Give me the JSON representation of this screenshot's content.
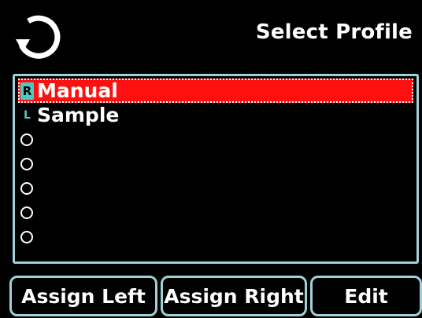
{
  "header": {
    "title": "Select Profile",
    "back_icon": "refresh-back-icon"
  },
  "list": {
    "items": [
      {
        "badge": "R",
        "label": "Manual",
        "selected": true
      },
      {
        "badge": "L",
        "label": "Sample",
        "selected": false
      },
      {
        "badge": "",
        "label": "",
        "selected": false
      },
      {
        "badge": "",
        "label": "",
        "selected": false
      },
      {
        "badge": "",
        "label": "",
        "selected": false
      },
      {
        "badge": "",
        "label": "",
        "selected": false
      },
      {
        "badge": "",
        "label": "",
        "selected": false
      }
    ]
  },
  "softkeys": {
    "assign_left": "Assign Left",
    "assign_right": "Assign Right",
    "edit": "Edit"
  },
  "colors": {
    "background": "#000000",
    "selected_row": "#ff1010",
    "border": "#9fd1d8",
    "badge": "#4fc8c4"
  }
}
